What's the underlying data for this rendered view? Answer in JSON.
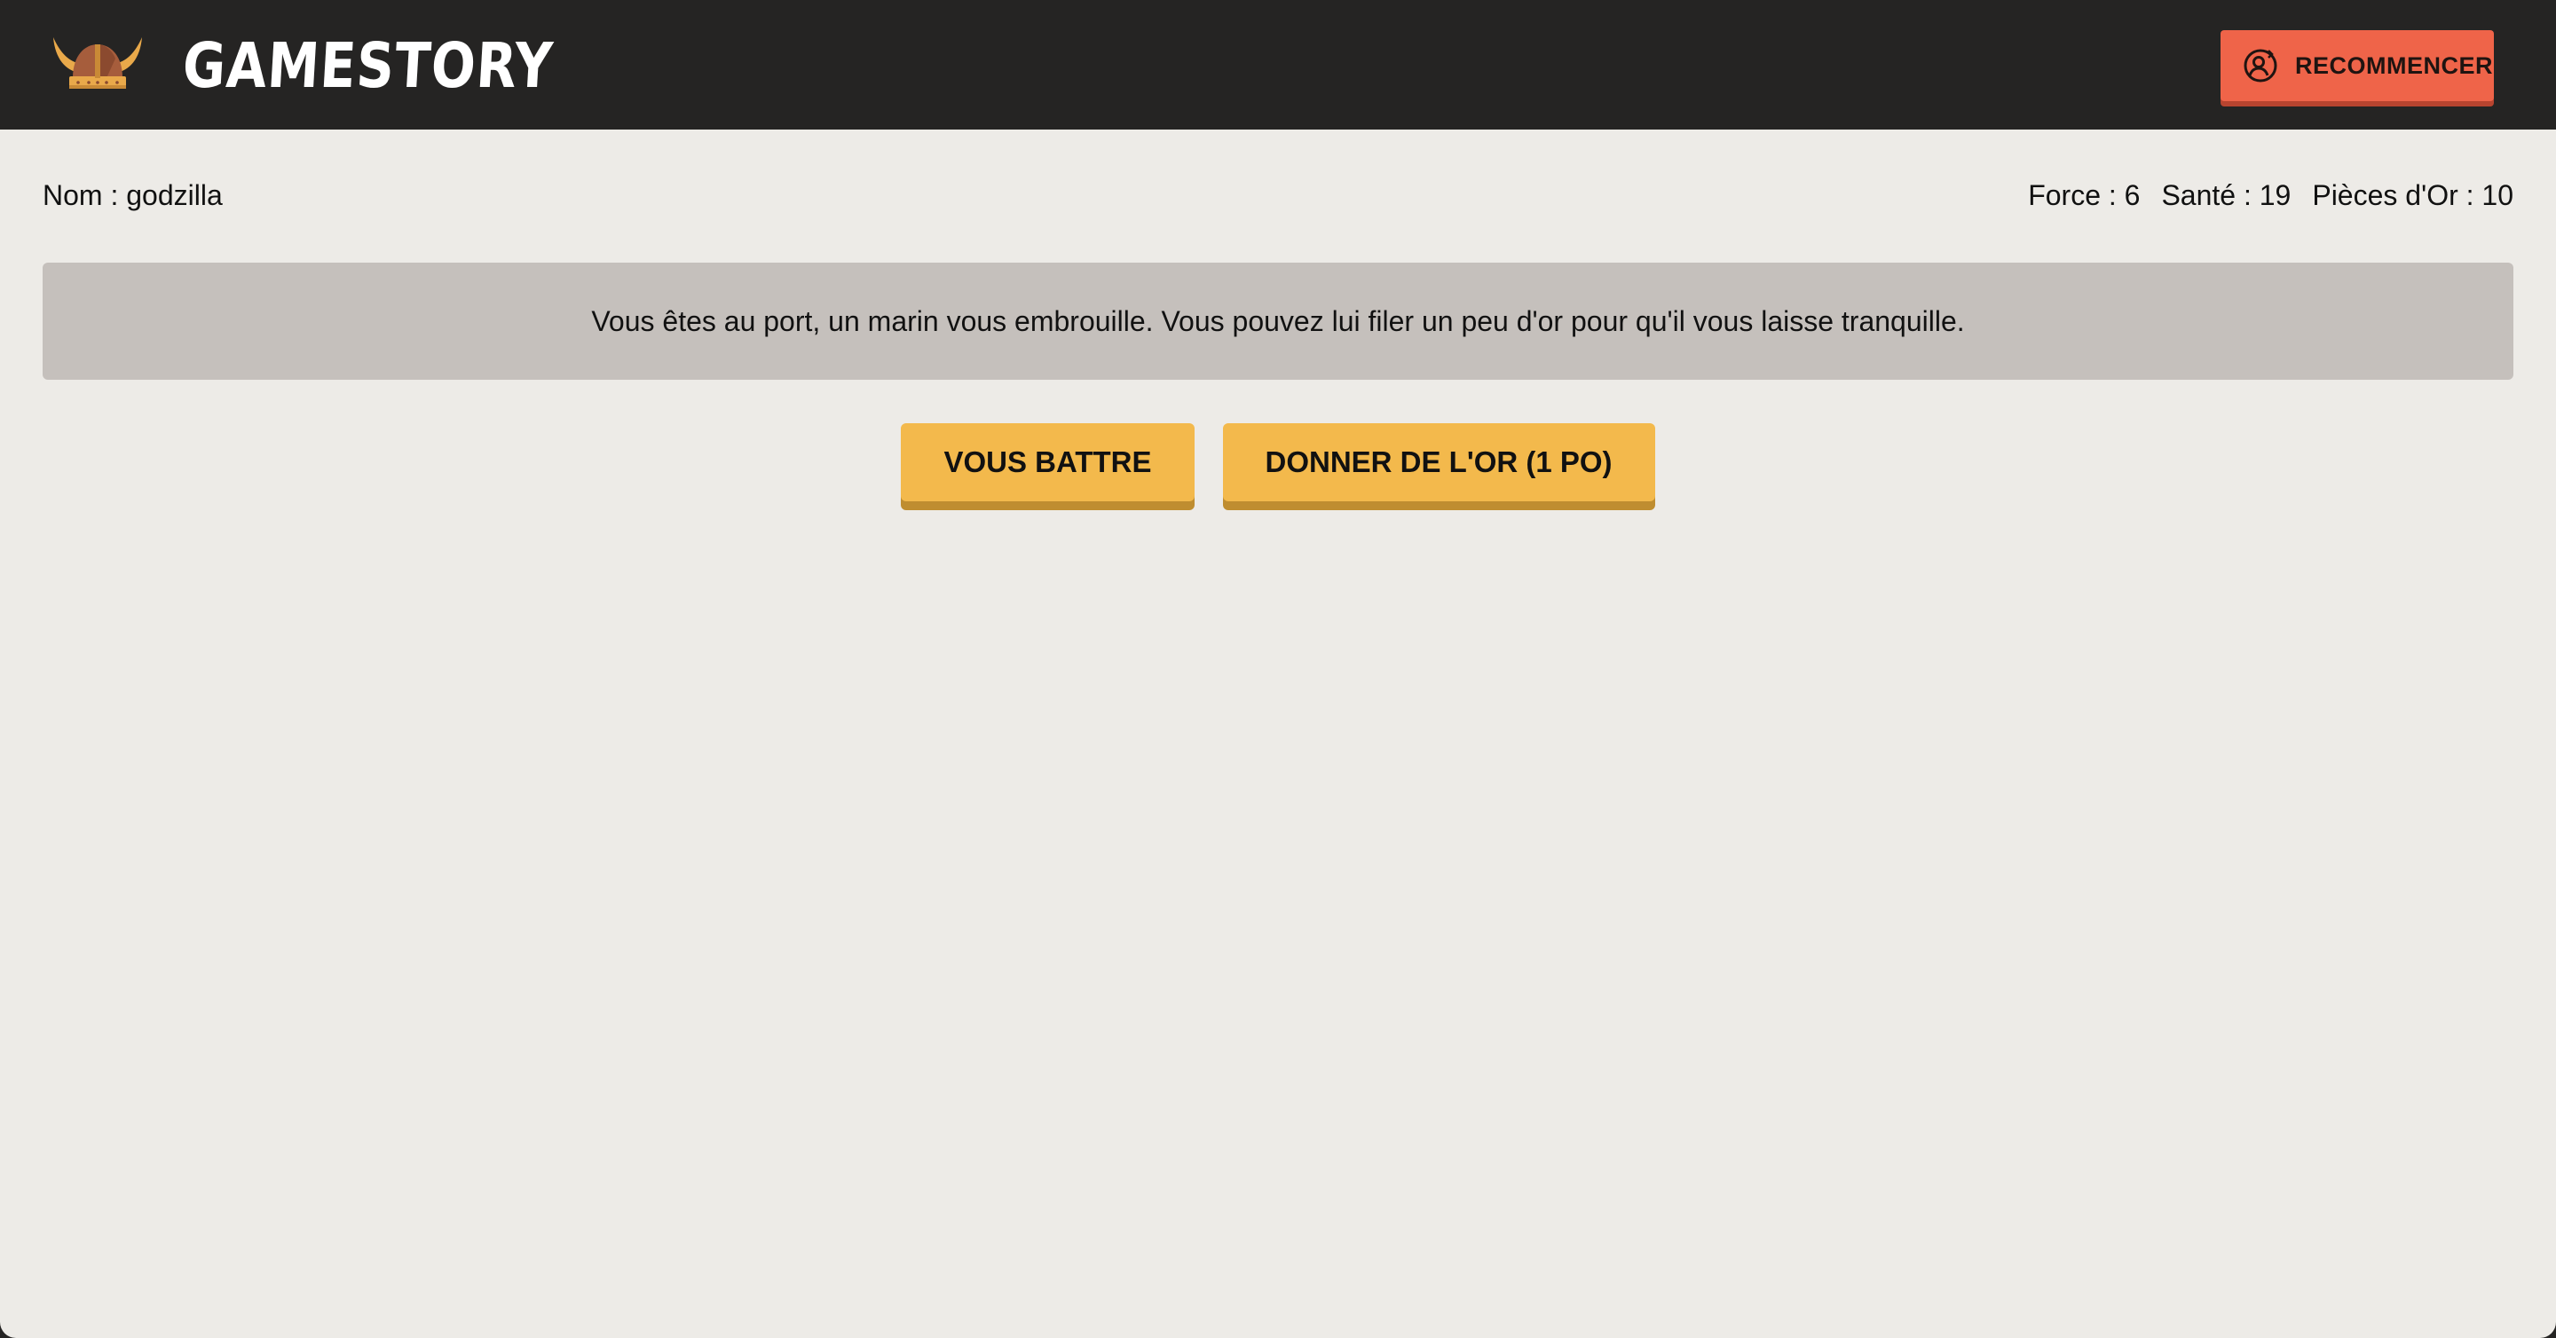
{
  "header": {
    "brand": "GAMESTORY",
    "logo_icon": "viking-helmet-icon",
    "restart_button": {
      "label": "RECOMMENCER",
      "icon": "user-refresh-icon",
      "color": "#ef6449"
    }
  },
  "player": {
    "name_text": "Nom : godzilla",
    "stats": [
      {
        "text": "Force : 6"
      },
      {
        "text": "Santé : 19"
      },
      {
        "text": "Pièces d'Or : 10"
      }
    ]
  },
  "story": {
    "text": "Vous êtes au port, un marin vous embrouille. Vous pouvez lui filer un peu d'or pour qu'il vous laisse tranquille."
  },
  "actions": [
    {
      "label": "VOUS BATTRE"
    },
    {
      "label": "DONNER DE L'OR (1 PO)"
    }
  ],
  "colors": {
    "topbar": "#252423",
    "background": "#edebe7",
    "narration_box": "#c5c0bc",
    "action_button": "#f3b94c",
    "accent": "#ef6449"
  }
}
